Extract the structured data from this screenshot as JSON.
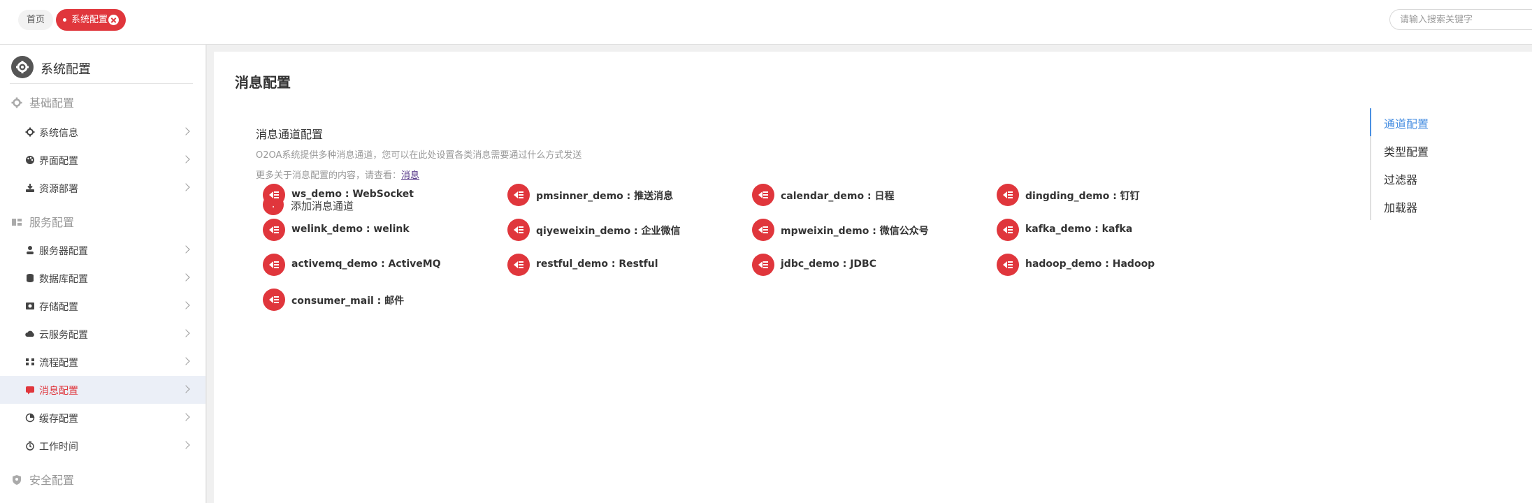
{
  "tabs": {
    "home": "首页",
    "active": "系统配置"
  },
  "search": {
    "placeholder": "请输入搜索关键字"
  },
  "sidebar": {
    "title": "系统配置",
    "groups": [
      {
        "label": "基础配置",
        "items": [
          {
            "label": "系统信息",
            "icon": "gear-icon"
          },
          {
            "label": "界面配置",
            "icon": "palette-icon"
          },
          {
            "label": "资源部署",
            "icon": "deploy-icon"
          }
        ]
      },
      {
        "label": "服务配置",
        "items": [
          {
            "label": "服务器配置",
            "icon": "server-icon"
          },
          {
            "label": "数据库配置",
            "icon": "database-icon"
          },
          {
            "label": "存储配置",
            "icon": "storage-icon"
          },
          {
            "label": "云服务配置",
            "icon": "cloud-icon"
          },
          {
            "label": "流程配置",
            "icon": "flow-icon"
          },
          {
            "label": "消息配置",
            "icon": "message-icon"
          },
          {
            "label": "缓存配置",
            "icon": "cache-icon"
          },
          {
            "label": "工作时间",
            "icon": "clock-icon"
          }
        ]
      },
      {
        "label": "安全配置",
        "items": []
      }
    ]
  },
  "main": {
    "title": "消息配置",
    "section_title": "消息通道配置",
    "section_desc": "O2OA系统提供多种消息通道，您可以在此处设置各类消息需要通过什么方式发送",
    "more_prefix": "更多关于消息配置的内容，请查看：",
    "more_link": "消息",
    "add_label": "添加消息通道",
    "channels": [
      "ws_demo : WebSocket",
      "pmsinner_demo : 推送消息",
      "calendar_demo : 日程",
      "dingding_demo : 钉钉",
      "welink_demo : welink",
      "qiyeweixin_demo : 企业微信",
      "mpweixin_demo : 微信公众号",
      "kafka_demo : kafka",
      "activemq_demo : ActiveMQ",
      "restful_demo : Restful",
      "jdbc_demo : JDBC",
      "hadoop_demo : Hadoop",
      "consumer_mail : 邮件"
    ]
  },
  "right_nav": [
    "通道配置",
    "类型配置",
    "过滤器",
    "加载器"
  ],
  "colors": {
    "accent": "#e0363c",
    "nav_active": "#4a90e2",
    "sidebar_active_bg": "#ebeff7"
  }
}
